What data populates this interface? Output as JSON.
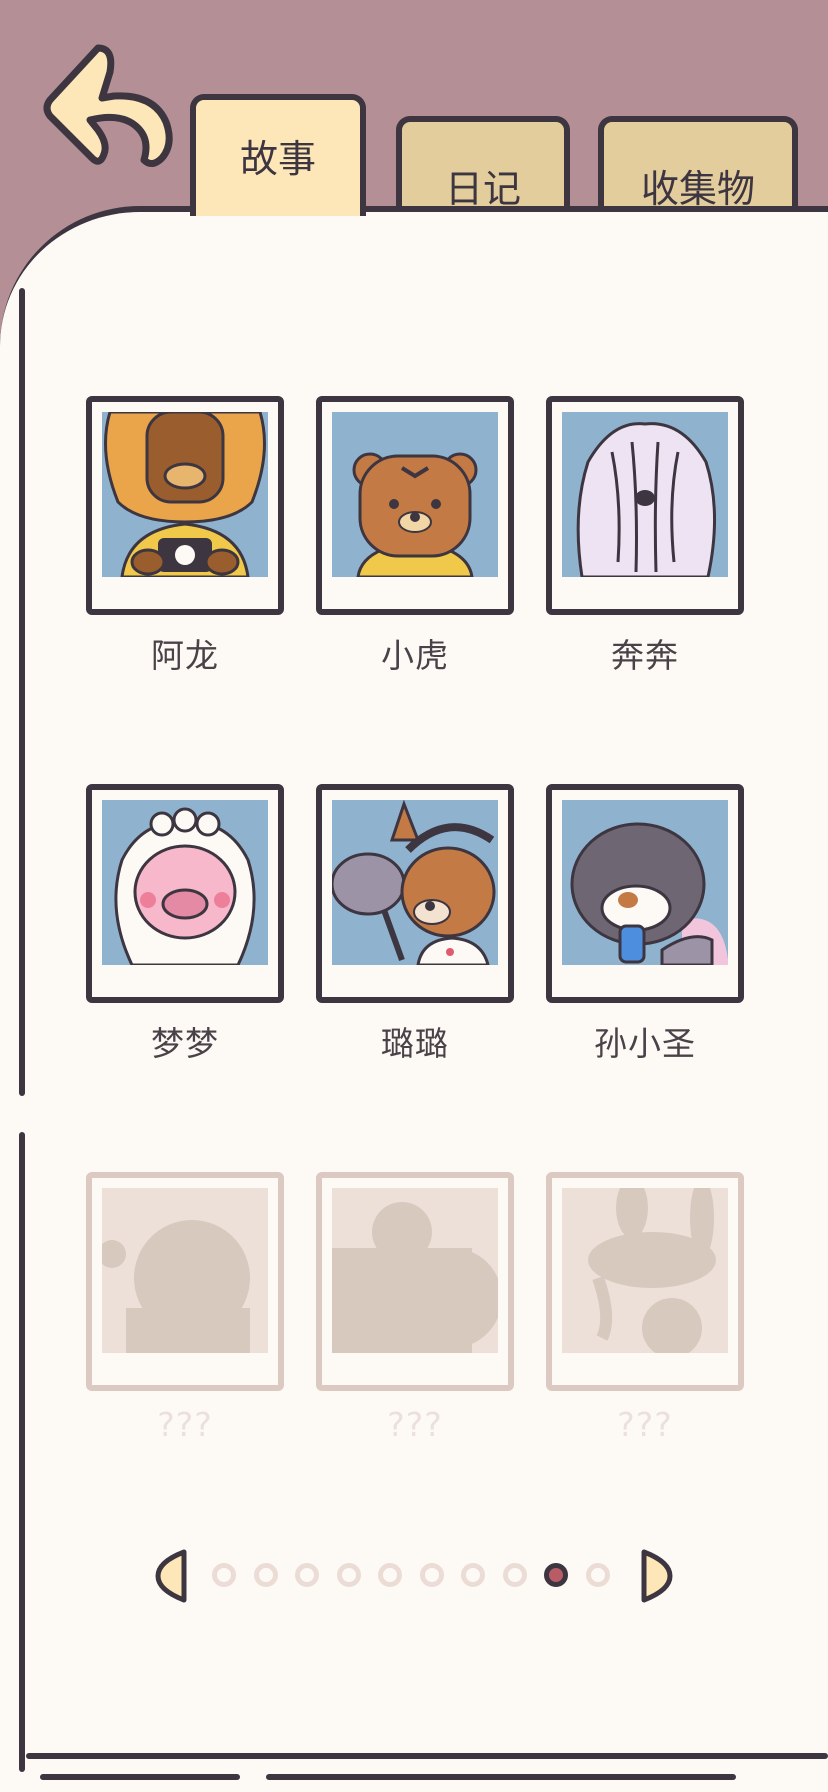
{
  "tabs": [
    {
      "label": "故事",
      "active": true
    },
    {
      "label": "日记",
      "active": false
    },
    {
      "label": "收集物",
      "active": false
    }
  ],
  "characters": [
    {
      "name": "阿龙",
      "unlocked": true,
      "icon": "lion-photographer-icon"
    },
    {
      "name": "小虎",
      "unlocked": true,
      "icon": "tiger-icon"
    },
    {
      "name": "奔奔",
      "unlocked": true,
      "icon": "lavender-sheepdog-icon"
    },
    {
      "name": "梦梦",
      "unlocked": true,
      "icon": "pink-bride-icon"
    },
    {
      "name": "璐璐",
      "unlocked": true,
      "icon": "deer-reporter-icon"
    },
    {
      "name": "孙小圣",
      "unlocked": true,
      "icon": "raccoon-phone-icon"
    },
    {
      "name": "???",
      "unlocked": false,
      "icon": "locked-silhouette-icon"
    },
    {
      "name": "???",
      "unlocked": false,
      "icon": "locked-silhouette-icon"
    },
    {
      "name": "???",
      "unlocked": false,
      "icon": "locked-silhouette-icon"
    }
  ],
  "pagination": {
    "total_pages": 10,
    "current_page": 9
  },
  "colors": {
    "background": "#b48f96",
    "paper": "#fdfaf6",
    "outline": "#3d3540",
    "tab_active": "#fde7b8",
    "tab_inactive": "#e3cd9c",
    "photo_bg": "#8fb3cf",
    "locked": "#dcc9c2",
    "current_dot": "#b85c66"
  }
}
